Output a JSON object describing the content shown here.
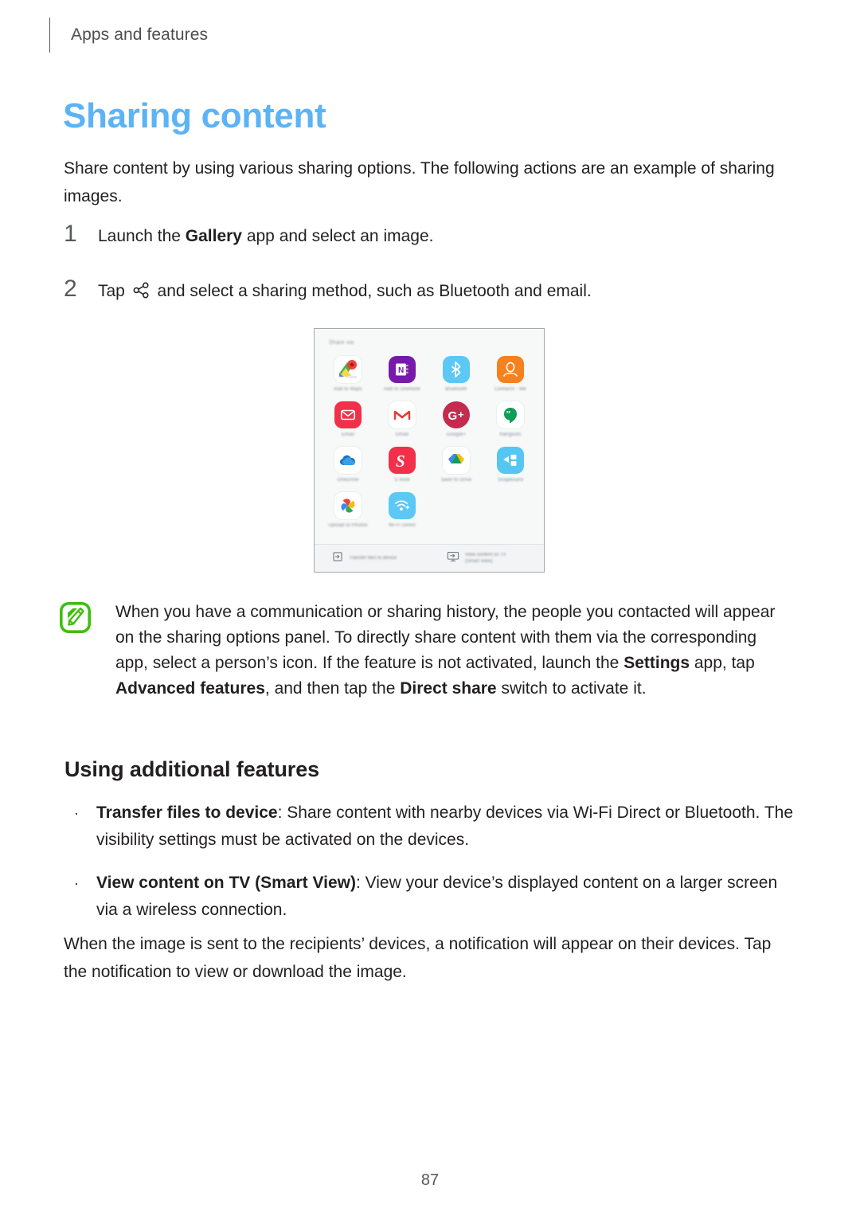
{
  "header": {
    "breadcrumb": "Apps and features"
  },
  "page_title": "Sharing content",
  "intro": "Share content by using various sharing options. The following actions are an example of sharing images.",
  "steps": [
    {
      "number": "1",
      "text_before": "Launch the ",
      "bold": "Gallery",
      "text_after": " app and select an image."
    },
    {
      "number": "2",
      "text_before": "Tap ",
      "icon": "share-icon",
      "text_after": " and select a sharing method, such as Bluetooth and email."
    }
  ],
  "screenshot": {
    "panel_title": "Share via",
    "apps": [
      {
        "name": "Add to Maps",
        "icon": "google-maps-icon"
      },
      {
        "name": "Add to OneNote",
        "icon": "onenote-icon"
      },
      {
        "name": "Bluetooth",
        "icon": "bluetooth-icon"
      },
      {
        "name": "Contacts - Me",
        "icon": "contacts-icon"
      },
      {
        "name": "Email",
        "icon": "samsung-email-icon"
      },
      {
        "name": "Gmail",
        "icon": "gmail-icon"
      },
      {
        "name": "Google+",
        "icon": "google-plus-icon"
      },
      {
        "name": "Hangouts",
        "icon": "hangouts-icon"
      },
      {
        "name": "OneDrive",
        "icon": "onedrive-icon"
      },
      {
        "name": "S Note",
        "icon": "s-note-icon"
      },
      {
        "name": "Save to Drive",
        "icon": "google-drive-icon"
      },
      {
        "name": "SnapBoard",
        "icon": "snapboard-icon"
      },
      {
        "name": "Upload to Photos",
        "icon": "google-photos-icon"
      },
      {
        "name": "Wi-Fi Direct",
        "icon": "wifi-direct-icon"
      }
    ],
    "footer_items": [
      {
        "label": "Transfer files to device",
        "icon": "transfer-files-icon"
      },
      {
        "label_line1": "View content on TV",
        "label_line2": "(Smart View)",
        "icon": "smart-view-icon"
      }
    ]
  },
  "note": {
    "icon": "note-pencil-icon",
    "icon_color": "#3fbe0d",
    "segments": [
      {
        "text": "When you have a communication or sharing history, the people you contacted will appear on the sharing options panel. To directly share content with them via the corresponding app, select a person’s icon. If the feature is not activated, launch the ",
        "bold": false
      },
      {
        "text": "Settings",
        "bold": true
      },
      {
        "text": " app, tap ",
        "bold": false
      },
      {
        "text": "Advanced features",
        "bold": true
      },
      {
        "text": ", and then tap the ",
        "bold": false
      },
      {
        "text": "Direct share",
        "bold": true
      },
      {
        "text": " switch to activate it.",
        "bold": false
      }
    ]
  },
  "subsection": {
    "heading": "Using additional features",
    "bullets": [
      {
        "marker": "·",
        "bold": "Transfer files to device",
        "rest": ": Share content with nearby devices via Wi-Fi Direct or Bluetooth. The visibility settings must be activated on the devices."
      },
      {
        "marker": "·",
        "bold": "View content on TV (Smart View)",
        "rest": ": View your device’s displayed content on a larger screen via a wireless connection."
      }
    ]
  },
  "closing": "When the image is sent to the recipients’ devices, a notification will appear on their devices. Tap the notification to view or download the image.",
  "page_number": "87",
  "colors": {
    "title_blue": "#5cb3f5",
    "body_text": "#231f20",
    "header_gray": "#4d4d4f",
    "note_green": "#3fbe0d"
  }
}
